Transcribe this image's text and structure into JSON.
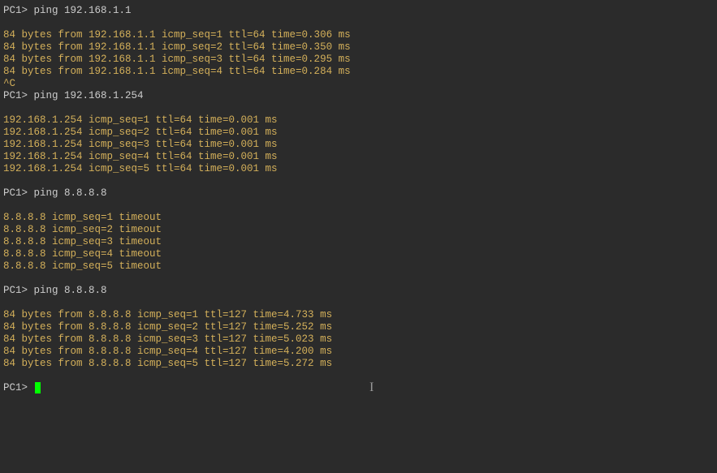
{
  "terminal": {
    "blocks": [
      {
        "type": "prompt",
        "text": "PC1> ping 192.168.1.1"
      },
      {
        "type": "blank"
      },
      {
        "type": "output",
        "text": "84 bytes from 192.168.1.1 icmp_seq=1 ttl=64 time=0.306 ms"
      },
      {
        "type": "output",
        "text": "84 bytes from 192.168.1.1 icmp_seq=2 ttl=64 time=0.350 ms"
      },
      {
        "type": "output",
        "text": "84 bytes from 192.168.1.1 icmp_seq=3 ttl=64 time=0.295 ms"
      },
      {
        "type": "output",
        "text": "84 bytes from 192.168.1.1 icmp_seq=4 ttl=64 time=0.284 ms"
      },
      {
        "type": "output",
        "text": "^C"
      },
      {
        "type": "prompt",
        "text": "PC1> ping 192.168.1.254"
      },
      {
        "type": "blank"
      },
      {
        "type": "output",
        "text": "192.168.1.254 icmp_seq=1 ttl=64 time=0.001 ms"
      },
      {
        "type": "output",
        "text": "192.168.1.254 icmp_seq=2 ttl=64 time=0.001 ms"
      },
      {
        "type": "output",
        "text": "192.168.1.254 icmp_seq=3 ttl=64 time=0.001 ms"
      },
      {
        "type": "output",
        "text": "192.168.1.254 icmp_seq=4 ttl=64 time=0.001 ms"
      },
      {
        "type": "output",
        "text": "192.168.1.254 icmp_seq=5 ttl=64 time=0.001 ms"
      },
      {
        "type": "blank"
      },
      {
        "type": "prompt",
        "text": "PC1> ping 8.8.8.8"
      },
      {
        "type": "blank"
      },
      {
        "type": "output",
        "text": "8.8.8.8 icmp_seq=1 timeout"
      },
      {
        "type": "output",
        "text": "8.8.8.8 icmp_seq=2 timeout"
      },
      {
        "type": "output",
        "text": "8.8.8.8 icmp_seq=3 timeout"
      },
      {
        "type": "output",
        "text": "8.8.8.8 icmp_seq=4 timeout"
      },
      {
        "type": "output",
        "text": "8.8.8.8 icmp_seq=5 timeout"
      },
      {
        "type": "blank"
      },
      {
        "type": "prompt",
        "text": "PC1> ping 8.8.8.8"
      },
      {
        "type": "blank"
      },
      {
        "type": "output",
        "text": "84 bytes from 8.8.8.8 icmp_seq=1 ttl=127 time=4.733 ms"
      },
      {
        "type": "output",
        "text": "84 bytes from 8.8.8.8 icmp_seq=2 ttl=127 time=5.252 ms"
      },
      {
        "type": "output",
        "text": "84 bytes from 8.8.8.8 icmp_seq=3 ttl=127 time=5.023 ms"
      },
      {
        "type": "output",
        "text": "84 bytes from 8.8.8.8 icmp_seq=4 ttl=127 time=4.200 ms"
      },
      {
        "type": "output",
        "text": "84 bytes from 8.8.8.8 icmp_seq=5 ttl=127 time=5.272 ms"
      },
      {
        "type": "blank"
      },
      {
        "type": "final-prompt",
        "text": "PC1> "
      }
    ]
  }
}
